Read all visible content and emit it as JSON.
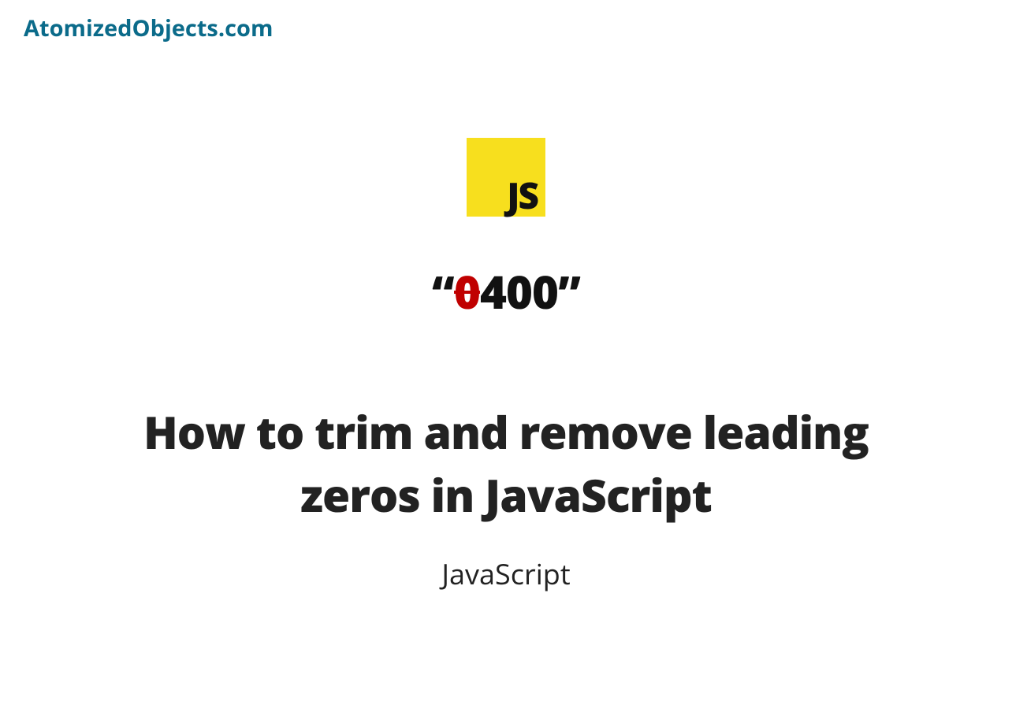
{
  "site_name": "AtomizedObjects.com",
  "logo": {
    "text": "JS",
    "bg_color": "#f7df1e"
  },
  "example": {
    "quote_open": "“",
    "strike_char": "0",
    "rest": "400",
    "quote_close": "”"
  },
  "title": "How to trim and remove leading zeros in JavaScript",
  "category": "JavaScript"
}
